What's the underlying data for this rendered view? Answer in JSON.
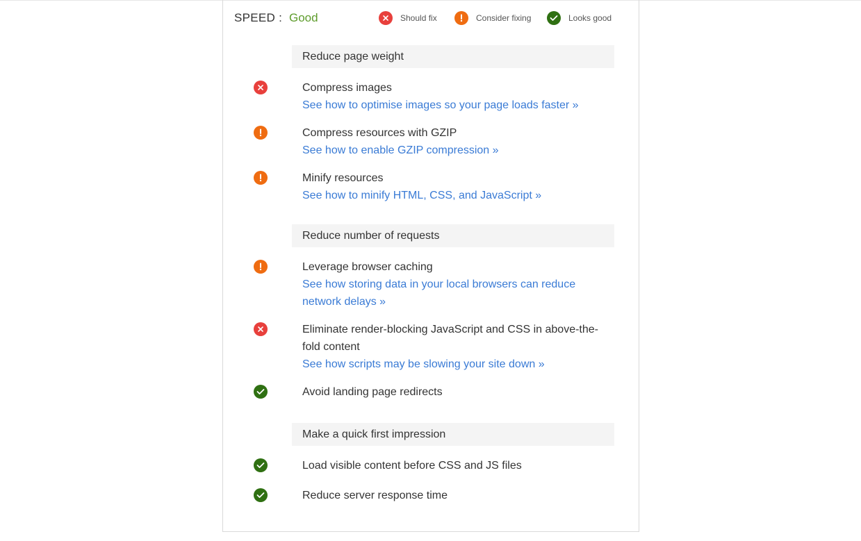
{
  "header": {
    "speed_label": "SPEED :",
    "speed_value": "Good",
    "legend": [
      {
        "icon": "x-icon",
        "status": "should-fix",
        "label": "Should fix",
        "color": "#e8403c"
      },
      {
        "icon": "exclamation-icon",
        "status": "consider-fixing",
        "label": "Consider fixing",
        "color": "#ef6c11"
      },
      {
        "icon": "check-icon",
        "status": "looks-good",
        "label": "Looks good",
        "color": "#2f7012"
      }
    ]
  },
  "sections": [
    {
      "title": "Reduce page weight",
      "items": [
        {
          "status": "should-fix",
          "title": "Compress images",
          "link": "See how to optimise images so your page loads faster »"
        },
        {
          "status": "consider-fixing",
          "title": "Compress resources with GZIP",
          "link": "See how to enable GZIP compression »"
        },
        {
          "status": "consider-fixing",
          "title": "Minify resources",
          "link": "See how to minify HTML, CSS, and JavaScript »"
        }
      ]
    },
    {
      "title": "Reduce number of requests",
      "items": [
        {
          "status": "consider-fixing",
          "title": "Leverage browser caching",
          "link": "See how storing data in your local browsers can reduce network delays »"
        },
        {
          "status": "should-fix",
          "title": "Eliminate render-blocking JavaScript and CSS in above-the-fold content",
          "link": "See how scripts may be slowing your site down »"
        },
        {
          "status": "looks-good",
          "title": "Avoid landing page redirects"
        }
      ]
    },
    {
      "title": "Make a quick first impression",
      "items": [
        {
          "status": "looks-good",
          "title": "Load visible content before CSS and JS files"
        },
        {
          "status": "looks-good",
          "title": "Reduce server response time"
        }
      ]
    }
  ],
  "colors": {
    "good_text": "#5e9c2c",
    "link": "#3a7bd5",
    "section_bg": "#f4f4f4"
  }
}
